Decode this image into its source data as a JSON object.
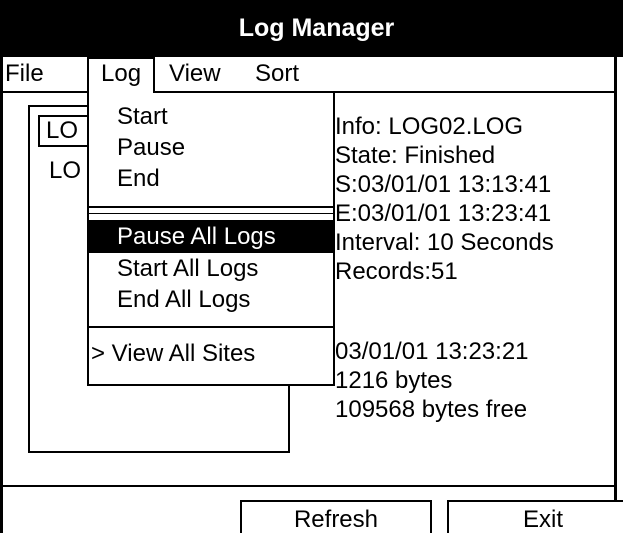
{
  "title": "Log Manager",
  "menubar": {
    "file": "File",
    "log": "Log",
    "view": "View",
    "sort": "Sort"
  },
  "log_menu": {
    "start": "Start",
    "pause": "Pause",
    "end": "End",
    "pause_all": "Pause All Logs",
    "start_all": "Start All Logs",
    "end_all": "End All Logs",
    "view_all_sites": "> View All Sites"
  },
  "log_list": {
    "item1": "LO",
    "item2": "LO"
  },
  "info": {
    "name": "Info: LOG02.LOG",
    "state": "State: Finished",
    "start": "S:03/01/01 13:13:41",
    "end": "E:03/01/01 13:23:41",
    "interval": "Interval: 10 Seconds",
    "records": "Records:51",
    "date": "03/01/01 13:23:21",
    "size": "1216 bytes",
    "free": "109568 bytes free"
  },
  "buttons": {
    "refresh": "Refresh",
    "exit": "Exit"
  }
}
